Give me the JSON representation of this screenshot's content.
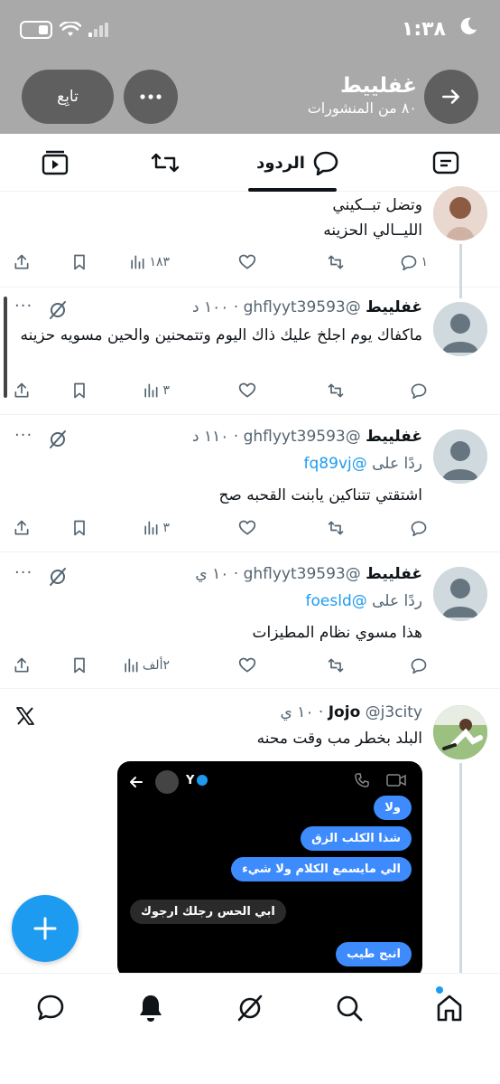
{
  "status_bar": {
    "time": "١:٣٨"
  },
  "header": {
    "name": "غفلييط",
    "post_count": "٨٠ من المنشورات",
    "follow_label": "تابِع"
  },
  "tabs": [
    {
      "label": "الردود",
      "active": true
    }
  ],
  "posts": [
    {
      "text_lines": [
        "وتضل تبــكيني",
        "الليــالي الحزينه"
      ],
      "replies": "١",
      "views": "١٨٣"
    },
    {
      "name": "غفلييط",
      "handle": "@ghflyyt39593",
      "time": "١٠٠ د",
      "text": "ماكفاك يوم اجلخ عليك ذاك اليوم وتتمحنين والحين مسويه حزينه",
      "views": "٣"
    },
    {
      "name": "غفلييط",
      "handle": "@ghflyyt39593",
      "time": "١١٠ د",
      "reply_prefix": "ردًا على",
      "reply_to": "@fq89vj",
      "text": "اشتقتي تتناكين يابنت القحبه صح",
      "views": "٣"
    },
    {
      "name": "غفلييط",
      "handle": "@ghflyyt39593",
      "time": "١٠ ي",
      "reply_prefix": "ردًا على",
      "reply_to": "@foesld",
      "text": "هذا مسوي نظام المطيزات",
      "views": "٢ألف"
    },
    {
      "name": "Jojo",
      "handle": "@j3city",
      "time": "١٠ ي",
      "text": "البلد بخطر مب وقت محنه",
      "media": {
        "contact": "Y",
        "bubbles": [
          {
            "text": "ولا",
            "style": "blue"
          },
          {
            "text": "شذا الكلب الزق",
            "style": "blue"
          },
          {
            "text": "الي مايسمع الكلام ولا شيء",
            "style": "blue"
          },
          {
            "text": "ابي الحس رجلك ارجوك",
            "style": "gray"
          },
          {
            "text": "انبح طيب",
            "style": "blue"
          }
        ]
      }
    }
  ],
  "colors": {
    "accent": "#1d9bf0",
    "header_bg": "#a9a9a9",
    "secondary_text": "#536471"
  }
}
